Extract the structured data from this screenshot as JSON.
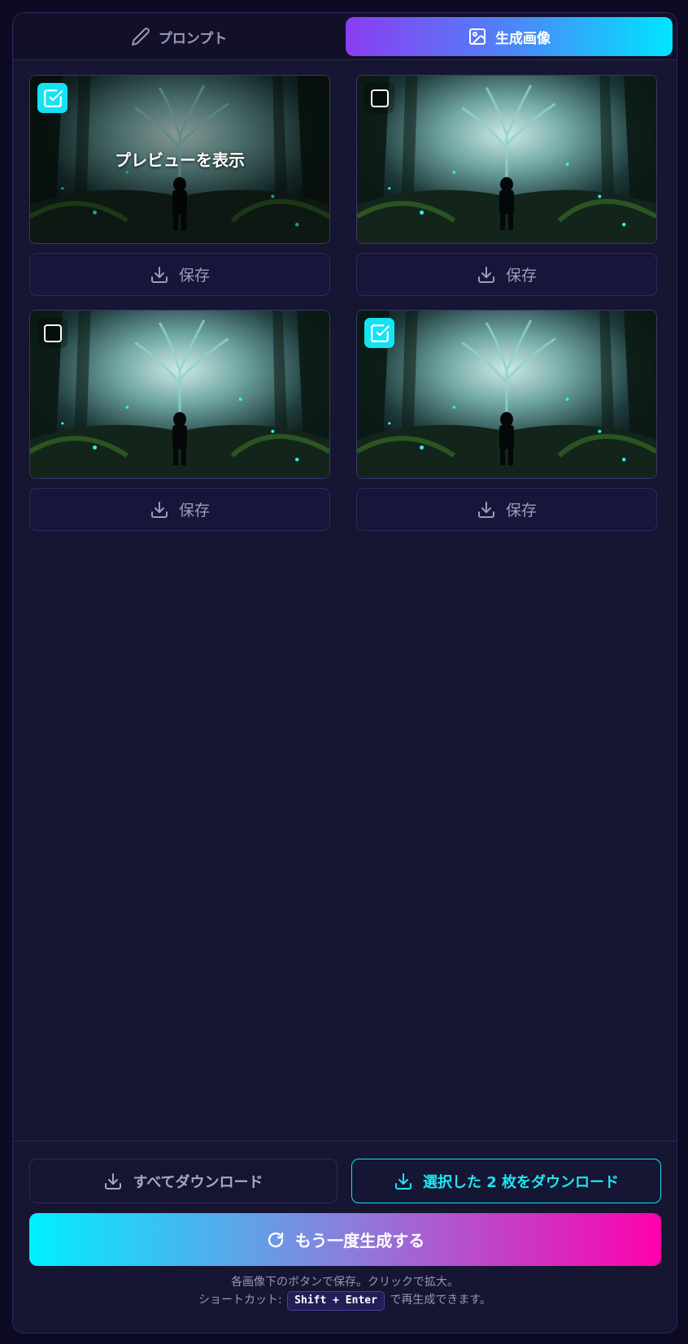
{
  "tabs": {
    "prompt_label": "プロンプト",
    "images_label": "生成画像",
    "active": "images"
  },
  "images": [
    {
      "selected": true,
      "overlay_label": "プレビューを表示",
      "save_label": "保存"
    },
    {
      "selected": false,
      "save_label": "保存"
    },
    {
      "selected": false,
      "save_label": "保存"
    },
    {
      "selected": true,
      "save_label": "保存"
    }
  ],
  "footer": {
    "download_all_label": "すべてダウンロード",
    "download_selected_label": "選択した 2 枚をダウンロード",
    "regenerate_label": "もう一度生成する",
    "hint_line1": "各画像下のボタンで保存。クリックで拡大。",
    "hint_shortcut_prefix": "ショートカット:",
    "hint_shortcut_key": "Shift + Enter",
    "hint_shortcut_suffix": "で再生成できます。"
  },
  "colors": {
    "accent_cyan": "#14e3f3",
    "accent_purple": "#8a3df2",
    "accent_pink": "#ff00ad",
    "panel_bg": "#161532"
  }
}
